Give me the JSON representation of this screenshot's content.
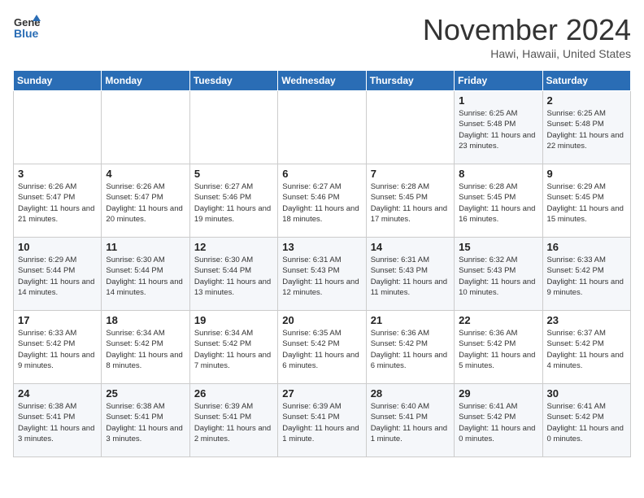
{
  "logo": {
    "line1": "General",
    "line2": "Blue"
  },
  "title": "November 2024",
  "location": "Hawi, Hawaii, United States",
  "days_of_week": [
    "Sunday",
    "Monday",
    "Tuesday",
    "Wednesday",
    "Thursday",
    "Friday",
    "Saturday"
  ],
  "weeks": [
    [
      {
        "day": "",
        "info": ""
      },
      {
        "day": "",
        "info": ""
      },
      {
        "day": "",
        "info": ""
      },
      {
        "day": "",
        "info": ""
      },
      {
        "day": "",
        "info": ""
      },
      {
        "day": "1",
        "info": "Sunrise: 6:25 AM\nSunset: 5:48 PM\nDaylight: 11 hours and 23 minutes."
      },
      {
        "day": "2",
        "info": "Sunrise: 6:25 AM\nSunset: 5:48 PM\nDaylight: 11 hours and 22 minutes."
      }
    ],
    [
      {
        "day": "3",
        "info": "Sunrise: 6:26 AM\nSunset: 5:47 PM\nDaylight: 11 hours and 21 minutes."
      },
      {
        "day": "4",
        "info": "Sunrise: 6:26 AM\nSunset: 5:47 PM\nDaylight: 11 hours and 20 minutes."
      },
      {
        "day": "5",
        "info": "Sunrise: 6:27 AM\nSunset: 5:46 PM\nDaylight: 11 hours and 19 minutes."
      },
      {
        "day": "6",
        "info": "Sunrise: 6:27 AM\nSunset: 5:46 PM\nDaylight: 11 hours and 18 minutes."
      },
      {
        "day": "7",
        "info": "Sunrise: 6:28 AM\nSunset: 5:45 PM\nDaylight: 11 hours and 17 minutes."
      },
      {
        "day": "8",
        "info": "Sunrise: 6:28 AM\nSunset: 5:45 PM\nDaylight: 11 hours and 16 minutes."
      },
      {
        "day": "9",
        "info": "Sunrise: 6:29 AM\nSunset: 5:45 PM\nDaylight: 11 hours and 15 minutes."
      }
    ],
    [
      {
        "day": "10",
        "info": "Sunrise: 6:29 AM\nSunset: 5:44 PM\nDaylight: 11 hours and 14 minutes."
      },
      {
        "day": "11",
        "info": "Sunrise: 6:30 AM\nSunset: 5:44 PM\nDaylight: 11 hours and 14 minutes."
      },
      {
        "day": "12",
        "info": "Sunrise: 6:30 AM\nSunset: 5:44 PM\nDaylight: 11 hours and 13 minutes."
      },
      {
        "day": "13",
        "info": "Sunrise: 6:31 AM\nSunset: 5:43 PM\nDaylight: 11 hours and 12 minutes."
      },
      {
        "day": "14",
        "info": "Sunrise: 6:31 AM\nSunset: 5:43 PM\nDaylight: 11 hours and 11 minutes."
      },
      {
        "day": "15",
        "info": "Sunrise: 6:32 AM\nSunset: 5:43 PM\nDaylight: 11 hours and 10 minutes."
      },
      {
        "day": "16",
        "info": "Sunrise: 6:33 AM\nSunset: 5:42 PM\nDaylight: 11 hours and 9 minutes."
      }
    ],
    [
      {
        "day": "17",
        "info": "Sunrise: 6:33 AM\nSunset: 5:42 PM\nDaylight: 11 hours and 9 minutes."
      },
      {
        "day": "18",
        "info": "Sunrise: 6:34 AM\nSunset: 5:42 PM\nDaylight: 11 hours and 8 minutes."
      },
      {
        "day": "19",
        "info": "Sunrise: 6:34 AM\nSunset: 5:42 PM\nDaylight: 11 hours and 7 minutes."
      },
      {
        "day": "20",
        "info": "Sunrise: 6:35 AM\nSunset: 5:42 PM\nDaylight: 11 hours and 6 minutes."
      },
      {
        "day": "21",
        "info": "Sunrise: 6:36 AM\nSunset: 5:42 PM\nDaylight: 11 hours and 6 minutes."
      },
      {
        "day": "22",
        "info": "Sunrise: 6:36 AM\nSunset: 5:42 PM\nDaylight: 11 hours and 5 minutes."
      },
      {
        "day": "23",
        "info": "Sunrise: 6:37 AM\nSunset: 5:42 PM\nDaylight: 11 hours and 4 minutes."
      }
    ],
    [
      {
        "day": "24",
        "info": "Sunrise: 6:38 AM\nSunset: 5:41 PM\nDaylight: 11 hours and 3 minutes."
      },
      {
        "day": "25",
        "info": "Sunrise: 6:38 AM\nSunset: 5:41 PM\nDaylight: 11 hours and 3 minutes."
      },
      {
        "day": "26",
        "info": "Sunrise: 6:39 AM\nSunset: 5:41 PM\nDaylight: 11 hours and 2 minutes."
      },
      {
        "day": "27",
        "info": "Sunrise: 6:39 AM\nSunset: 5:41 PM\nDaylight: 11 hours and 1 minute."
      },
      {
        "day": "28",
        "info": "Sunrise: 6:40 AM\nSunset: 5:41 PM\nDaylight: 11 hours and 1 minute."
      },
      {
        "day": "29",
        "info": "Sunrise: 6:41 AM\nSunset: 5:42 PM\nDaylight: 11 hours and 0 minutes."
      },
      {
        "day": "30",
        "info": "Sunrise: 6:41 AM\nSunset: 5:42 PM\nDaylight: 11 hours and 0 minutes."
      }
    ]
  ]
}
